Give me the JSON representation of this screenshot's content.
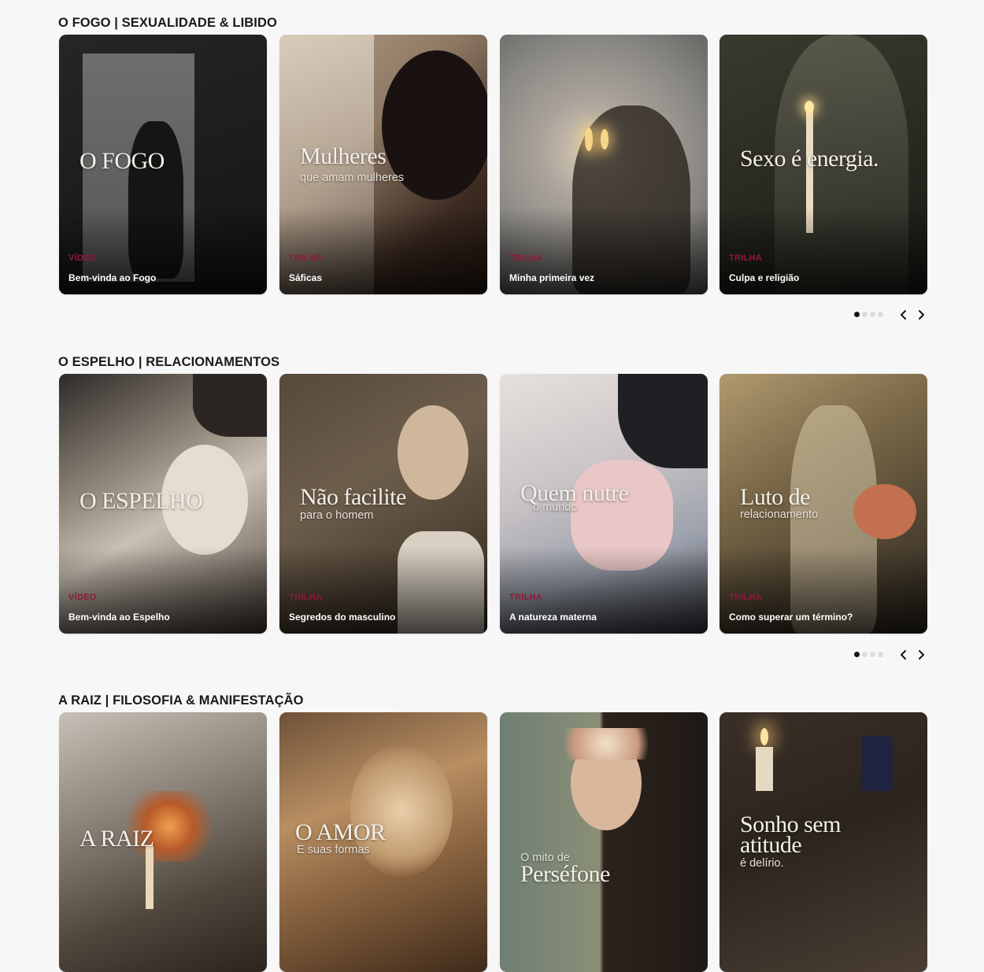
{
  "sections": [
    {
      "title": "O FOGO | SEXUALIDADE & LIBIDO",
      "cards": [
        {
          "big": "O FOGO",
          "small": "",
          "kind": "VÍDEO",
          "title": "Bem-vinda ao Fogo"
        },
        {
          "big": "Mulheres",
          "small": "que amam mulheres",
          "kind": "TRILHA",
          "title": "Sáficas"
        },
        {
          "big": "",
          "small": "",
          "kind": "TRILHA",
          "title": "Minha primeira vez"
        },
        {
          "big": "Sexo é energia.",
          "small": "",
          "kind": "TRILHA",
          "title": "Culpa e religião"
        }
      ]
    },
    {
      "title": "O ESPELHO | RELACIONAMENTOS",
      "cards": [
        {
          "big": "O ESPELHO",
          "small": "",
          "kind": "VÍDEO",
          "title": "Bem-vinda ao Espelho"
        },
        {
          "big": "Não facilite",
          "small": "para o homem",
          "kind": "TRILHA",
          "title": "Segredos do masculino"
        },
        {
          "big": "Quem nutre",
          "small": "o mundo",
          "kind": "TRILHA",
          "title": "A natureza materna"
        },
        {
          "big": "Luto de",
          "small": "relacionamento",
          "kind": "TRILHA",
          "title": "Como superar um término?"
        }
      ]
    },
    {
      "title": "A RAIZ | FILOSOFIA & MANIFESTAÇÃO",
      "cards": [
        {
          "big": "A RAIZ",
          "small": "",
          "kind": "",
          "title": ""
        },
        {
          "big": "O AMOR",
          "small": "E suas formas",
          "kind": "",
          "title": ""
        },
        {
          "big": "Perséfone",
          "small": "O mito de",
          "kind": "",
          "title": ""
        },
        {
          "big": "Sonho sem",
          "big2": "atitude",
          "small": "é delírio.",
          "kind": "",
          "title": ""
        }
      ]
    }
  ],
  "carousel": {
    "pages": 4,
    "active": 1
  },
  "icons": {
    "prev": "chevron-left-icon",
    "next": "chevron-right-icon"
  },
  "colors": {
    "kind_label": "#8e1a3a",
    "active_dot": "#141414",
    "inactive_dot": "#dcdcdc"
  }
}
